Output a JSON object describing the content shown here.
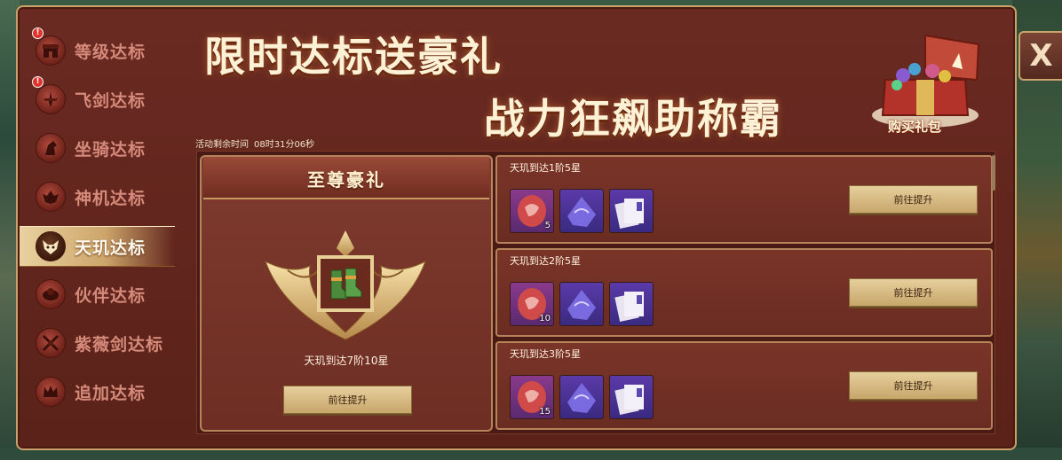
{
  "close_label": "X",
  "sidebar": {
    "tabs": [
      {
        "label": "等级达标",
        "badge": "!",
        "icon": "shop-icon"
      },
      {
        "label": "飞剑达标",
        "badge": "!",
        "icon": "flying-sword-icon"
      },
      {
        "label": "坐骑达标",
        "badge": "",
        "icon": "horse-head-icon"
      },
      {
        "label": "神机达标",
        "badge": "",
        "icon": "wing-icon"
      },
      {
        "label": "天玑达标",
        "badge": "",
        "icon": "demon-mask-icon",
        "active": true
      },
      {
        "label": "伙伴达标",
        "badge": "",
        "icon": "partner-icon"
      },
      {
        "label": "紫薇剑达标",
        "badge": "",
        "icon": "crossed-swords-icon"
      },
      {
        "label": "追加达标",
        "badge": "",
        "icon": "crown-icon"
      }
    ]
  },
  "banner": {
    "line1": "限时达标送豪礼",
    "line2": "战力狂飙助称霸",
    "buy_gift_label": "购买礼包"
  },
  "countdown": {
    "label": "活动剩余时间",
    "time": "08时31分06秒"
  },
  "supreme": {
    "title": "至尊豪礼",
    "item_icon": "boots-icon",
    "condition": "天玑到达7阶10星",
    "button_label": "前往提升"
  },
  "rows": [
    {
      "title": "天玑到达1阶5星",
      "button_label": "前往提升",
      "items": [
        {
          "icon": "red-gem-icon",
          "count": "5"
        },
        {
          "icon": "purple-crystal-icon",
          "count": ""
        },
        {
          "icon": "scroll-cards-icon",
          "count": ""
        }
      ]
    },
    {
      "title": "天玑到达2阶5星",
      "button_label": "前往提升",
      "items": [
        {
          "icon": "red-gem-icon",
          "count": "10"
        },
        {
          "icon": "purple-crystal-icon",
          "count": ""
        },
        {
          "icon": "scroll-cards-icon",
          "count": ""
        }
      ]
    },
    {
      "title": "天玑到达3阶5星",
      "button_label": "前往提升",
      "items": [
        {
          "icon": "red-gem-icon",
          "count": "15"
        },
        {
          "icon": "purple-crystal-icon",
          "count": ""
        },
        {
          "icon": "scroll-cards-icon",
          "count": ""
        }
      ]
    }
  ],
  "colors": {
    "frame": "#5a2219",
    "gold": "#c9a26a",
    "active_tab": "#e9d2a0",
    "tab_text": "#d58a7a"
  }
}
